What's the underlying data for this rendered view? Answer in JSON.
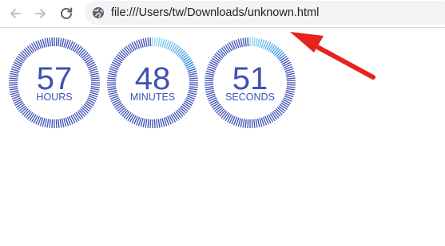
{
  "browser": {
    "url": "file:///Users/tw/Downloads/unknown.html",
    "back_icon": "arrow-left-icon",
    "forward_icon": "arrow-right-icon",
    "reload_icon": "reload-icon",
    "site_info_icon": "globe-icon"
  },
  "timers": [
    {
      "value": "57",
      "unit": "HOURS",
      "progress": 0.0
    },
    {
      "value": "48",
      "unit": "MINUTES",
      "progress": 0.2
    },
    {
      "value": "51",
      "unit": "SECONDS",
      "progress": 0.15
    }
  ],
  "colors": {
    "ring": "#3f51b5",
    "ring_progress": "#29b6f6",
    "annotation_arrow": "#e8231e"
  }
}
